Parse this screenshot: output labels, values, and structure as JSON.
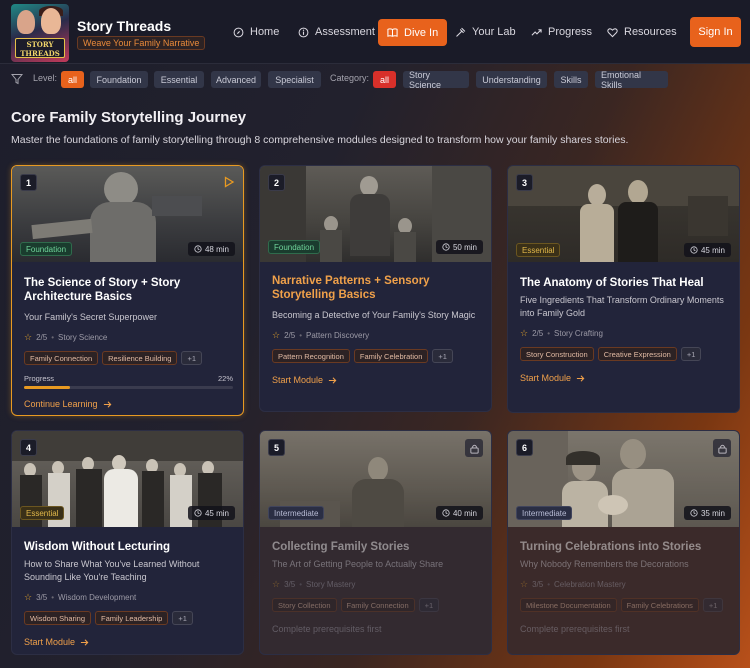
{
  "brand": {
    "logo_text": "STORY THREADS",
    "title": "Story Threads",
    "tagline": "Weave Your Family Narrative"
  },
  "nav": {
    "items": [
      {
        "label": "Home",
        "icon": "compass-icon"
      },
      {
        "label": "Assessment",
        "icon": "info-circle-icon"
      },
      {
        "label": "Dive In",
        "icon": "book-icon",
        "active": true
      },
      {
        "label": "Your Lab",
        "icon": "flask-icon"
      },
      {
        "label": "Progress",
        "icon": "trend-icon"
      },
      {
        "label": "Resources",
        "icon": "heart-icon"
      }
    ],
    "signin": "Sign In"
  },
  "filters": {
    "level_label": "Level:",
    "levels": [
      "all",
      "Foundation",
      "Essential",
      "Advanced",
      "Specialist"
    ],
    "category_label": "Category:",
    "categories": [
      "all",
      "Story Science",
      "Understanding",
      "Skills",
      "Emotional Skills"
    ]
  },
  "page": {
    "title": "Core Family Storytelling Journey",
    "subtitle": "Master the foundations of family storytelling through 8 comprehensive modules designed to transform how your family shares stories."
  },
  "modules": [
    {
      "number": "1",
      "level": "Foundation",
      "duration": "48 min",
      "title": "The Science of Story + Story Architecture Basics",
      "description": "Your Family's Secret Superpower",
      "rating": "2/5",
      "category": "Story Science",
      "tags": [
        "Family Connection",
        "Resilience Building",
        "+1"
      ],
      "progress_label": "Progress",
      "progress_value": "22%",
      "progress": 0.22,
      "action": "Continue Learning"
    },
    {
      "number": "2",
      "level": "Foundation",
      "duration": "50 min",
      "title": "Narrative Patterns + Sensory Storytelling Basics",
      "description": "Becoming a Detective of Your Family's Story Magic",
      "rating": "2/5",
      "category": "Pattern Discovery",
      "tags": [
        "Pattern Recognition",
        "Family Celebration",
        "+1"
      ],
      "action": "Start Module"
    },
    {
      "number": "3",
      "level": "Essential",
      "duration": "45 min",
      "title": "The Anatomy of Stories That Heal",
      "description": "Five Ingredients That Transform Ordinary Moments into Family Gold",
      "rating": "2/5",
      "category": "Story Crafting",
      "tags": [
        "Story Construction",
        "Creative Expression",
        "+1"
      ],
      "action": "Start Module"
    },
    {
      "number": "4",
      "level": "Essential",
      "duration": "45 min",
      "title": "Wisdom Without Lecturing",
      "description": "How to Share What You've Learned Without Sounding Like You're Teaching",
      "rating": "3/5",
      "category": "Wisdom Development",
      "tags": [
        "Wisdom Sharing",
        "Family Leadership",
        "+1"
      ],
      "action": "Start Module"
    },
    {
      "number": "5",
      "level": "Intermediate",
      "duration": "40 min",
      "title": "Collecting Family Stories",
      "description": "The Art of Getting People to Actually Share",
      "rating": "3/5",
      "category": "Story Mastery",
      "tags": [
        "Story Collection",
        "Family Connection",
        "+1"
      ],
      "action": "Complete prerequisites first"
    },
    {
      "number": "6",
      "level": "Intermediate",
      "duration": "35 min",
      "title": "Turning Celebrations into Stories",
      "description": "Why Nobody Remembers the Decorations",
      "rating": "3/5",
      "category": "Celebration Mastery",
      "tags": [
        "Milestone Documentation",
        "Family Celebrations",
        "+1"
      ],
      "action": "Complete prerequisites first"
    }
  ]
}
